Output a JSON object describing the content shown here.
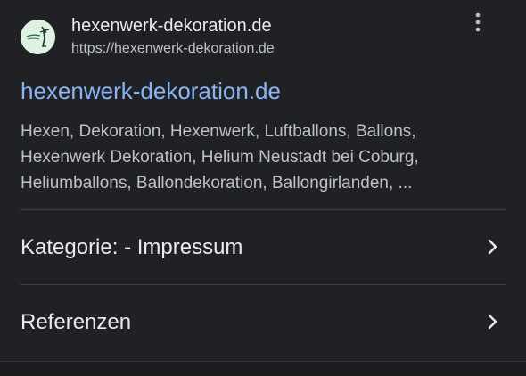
{
  "source": {
    "site_name": "hexenwerk-dekoration.de",
    "url": "https://hexenwerk-dekoration.de",
    "favicon_icon": "hexenwerk-logo-icon",
    "menu_icon": "more-vert-icon"
  },
  "result": {
    "title": "hexenwerk-dekoration.de",
    "snippet": "Hexen, Dekoration, Hexenwerk, Luftballons, Ballons, Hexenwerk Dekoration, Helium Neustadt bei Coburg, Heliumballons, Ballondekoration, Ballongirlanden, ..."
  },
  "sitelinks": [
    {
      "label": "Kategorie: - Impressum",
      "icon": "chevron-right-icon"
    },
    {
      "label": "Referenzen",
      "icon": "chevron-right-icon"
    }
  ],
  "colors": {
    "background": "#202124",
    "link": "#8ab4f8",
    "text": "#e8eaed",
    "secondary_text": "#bdc1c6",
    "divider": "#3c4043"
  }
}
